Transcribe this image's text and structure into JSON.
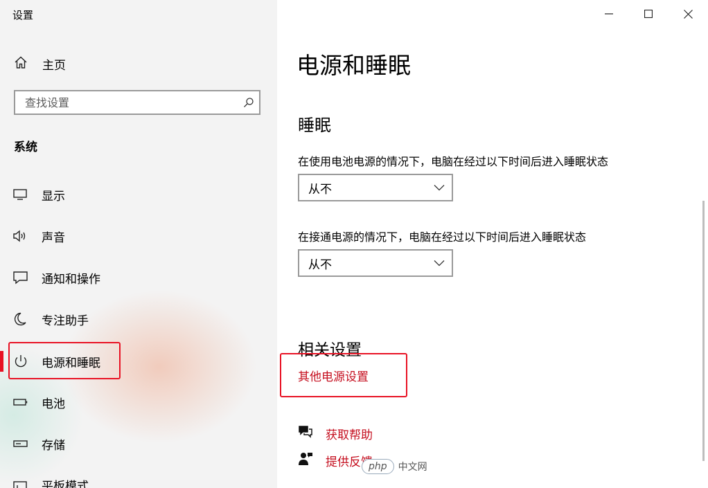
{
  "app": {
    "title": "设置"
  },
  "sidebar": {
    "home_label": "主页",
    "search_placeholder": "查找设置",
    "section": "系统",
    "items": [
      {
        "label": "显示",
        "icon": "monitor-icon"
      },
      {
        "label": "声音",
        "icon": "speaker-icon"
      },
      {
        "label": "通知和操作",
        "icon": "notification-icon"
      },
      {
        "label": "专注助手",
        "icon": "moon-icon"
      },
      {
        "label": "电源和睡眠",
        "icon": "power-icon",
        "selected": true
      },
      {
        "label": "电池",
        "icon": "battery-icon"
      },
      {
        "label": "存储",
        "icon": "storage-icon"
      },
      {
        "label": "平板模式",
        "icon": "tablet-icon"
      }
    ]
  },
  "window_controls": [
    "minimize",
    "maximize",
    "close"
  ],
  "main": {
    "title": "电源和睡眠",
    "sleep_heading": "睡眠",
    "battery_desc": "在使用电池电源的情况下，电脑在经过以下时间后进入睡眠状态",
    "battery_value": "从不",
    "plugged_desc": "在接通电源的情况下，电脑在经过以下时间后进入睡眠状态",
    "plugged_value": "从不",
    "related_heading": "相关设置",
    "related_link": "其他电源设置",
    "help_link": "获取帮助",
    "feedback_link": "提供反馈"
  },
  "watermark": {
    "badge": "php",
    "text": "中文网"
  },
  "colors": {
    "accent": "#e81123",
    "link": "#c50f1f",
    "sidebar_bg": "#f3f3f3"
  }
}
